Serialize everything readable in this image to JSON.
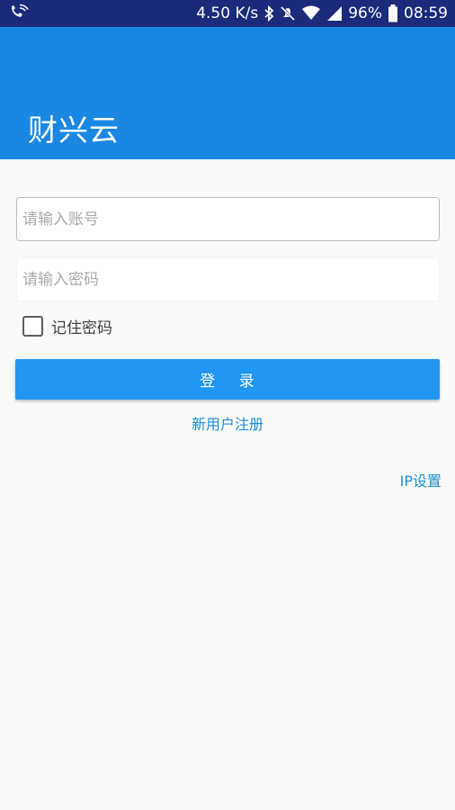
{
  "status_bar": {
    "speed": "4.50 K/s",
    "battery": "96%",
    "time": "08:59",
    "icons": [
      "phone-wifi-icon",
      "bluetooth-icon",
      "mute-icon",
      "wifi-icon",
      "signal-icon",
      "battery-icon"
    ]
  },
  "header": {
    "title": "财兴云",
    "color": "#1a88e3"
  },
  "form": {
    "account_placeholder": "请输入账号",
    "password_placeholder": "请输入密码",
    "remember_label": "记住密码",
    "remember_checked": false,
    "login_label": "登 录",
    "register_label": "新用户注册",
    "ip_settings_label": "IP设置"
  },
  "colors": {
    "primary": "#2196f3",
    "link": "#1b8fd8",
    "status_bar": "#1b2a7a"
  }
}
